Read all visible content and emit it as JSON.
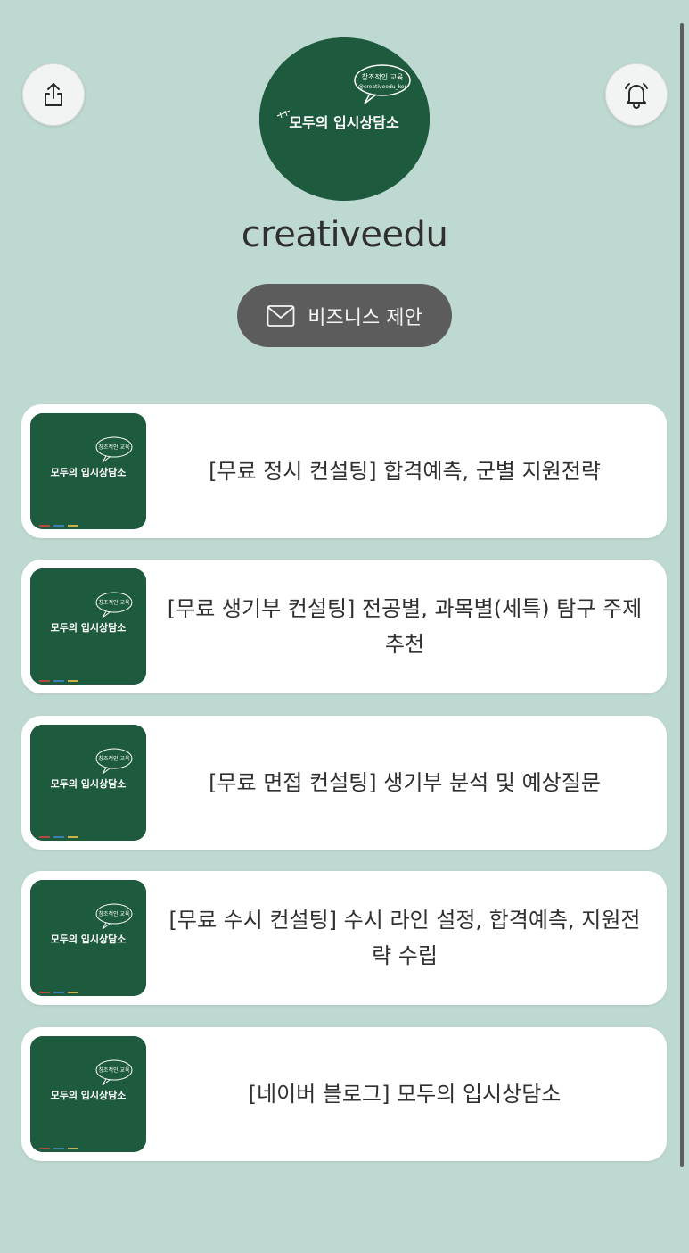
{
  "header": {
    "share_icon": "share-icon",
    "bell_icon": "bell-icon"
  },
  "profile": {
    "logo_bubble_line1": "창조적인 교육",
    "logo_bubble_line2": "@creativeedu_kor",
    "logo_title": "모두의 입시상담소",
    "name": "creativeedu"
  },
  "business_button": {
    "icon": "mail-icon",
    "label": "비즈니스 제안"
  },
  "links": [
    {
      "title": "[무료 정시 컨설팅] 합격예측, 군별 지원전략",
      "thumb_title": "모두의 입시상담소",
      "thumb_bubble": "창조적인 교육"
    },
    {
      "title": "[무료 생기부 컨설팅] 전공별, 과목별(세특) 탐구 주제 추천",
      "thumb_title": "모두의 입시상담소",
      "thumb_bubble": "창조적인 교육"
    },
    {
      "title": "[무료 면접 컨설팅] 생기부 분석 및 예상질문",
      "thumb_title": "모두의 입시상담소",
      "thumb_bubble": "창조적인 교육"
    },
    {
      "title": "[무료 수시 컨설팅] 수시 라인 설정, 합격예측, 지원전략 수립",
      "thumb_title": "모두의 입시상담소",
      "thumb_bubble": "창조적인 교육"
    },
    {
      "title": "[네이버 블로그] 모두의 입시상담소",
      "thumb_title": "모두의 입시상담소",
      "thumb_bubble": "창조적인 교육"
    }
  ],
  "colors": {
    "background": "#bed9d1",
    "chalkboard": "#1e5a3e",
    "button_dark": "#5c5c5c",
    "card": "#ffffff"
  }
}
